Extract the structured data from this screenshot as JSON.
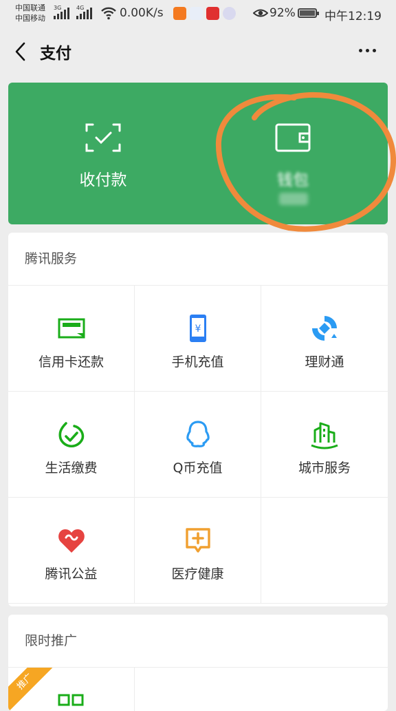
{
  "status": {
    "carrier1": "中国联通",
    "carrier2": "中国移动",
    "net1": "3G",
    "net2": "4G",
    "speed": "0.00K/s",
    "battery": "92%",
    "battery_level": 0.92,
    "time": "中午12:19"
  },
  "nav": {
    "title": "支付"
  },
  "green_card": {
    "receive_pay_label": "收付款",
    "wallet_label": "钱包",
    "bg_color": "#3daa63",
    "annotation_color": "#f08a3c"
  },
  "tencent_services": {
    "header": "腾讯服务",
    "items": [
      {
        "label": "信用卡还款",
        "icon": "credit-card-icon",
        "color": "#1aad19"
      },
      {
        "label": "手机充值",
        "icon": "phone-topup-icon",
        "color": "#2b7ff3"
      },
      {
        "label": "理财通",
        "icon": "wealth-icon",
        "color": "#2b9bf3"
      },
      {
        "label": "生活缴费",
        "icon": "utilities-icon",
        "color": "#1aad19"
      },
      {
        "label": "Q币充值",
        "icon": "qq-coin-icon",
        "color": "#2b9bf3"
      },
      {
        "label": "城市服务",
        "icon": "city-service-icon",
        "color": "#1aad19"
      },
      {
        "label": "腾讯公益",
        "icon": "charity-icon",
        "color": "#e64340"
      },
      {
        "label": "医疗健康",
        "icon": "medical-icon",
        "color": "#f0a030"
      }
    ]
  },
  "promotion": {
    "header": "限时推广",
    "badge": "推广"
  }
}
